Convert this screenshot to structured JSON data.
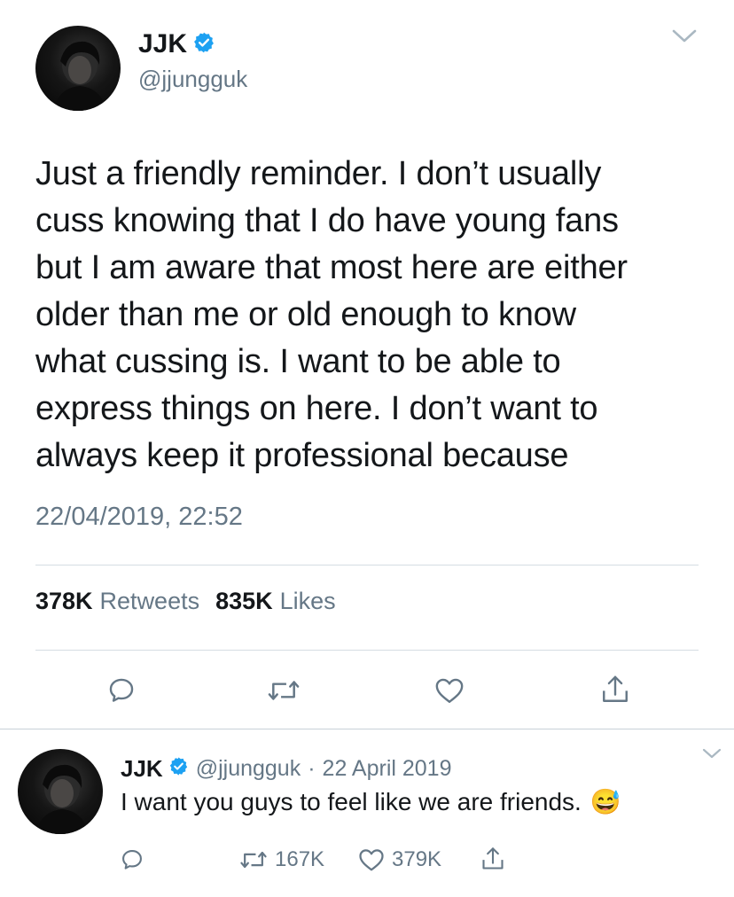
{
  "main_tweet": {
    "display_name": "JJK",
    "handle": "@jjungguk",
    "text": "Just a friendly reminder. I don’t usually\ncuss knowing that I do have young fans\nbut I am aware that most here are either\nolder than me or old enough to know\nwhat cussing is. I want to be able to\nexpress things on here. I don’t want to\nalways keep it professional because",
    "timestamp": "22/04/2019, 22:52",
    "retweets_count": "378K",
    "retweets_label": "Retweets",
    "likes_count": "835K",
    "likes_label": "Likes"
  },
  "reply_tweet": {
    "display_name": "JJK",
    "handle": "@jjungguk",
    "separator": "·",
    "date": "22 April 2019",
    "text": "I want you guys to feel like we are friends.",
    "emoji": "😅",
    "retweet_count": "167K",
    "like_count": "379K"
  },
  "colors": {
    "verified": "#1da1f2",
    "muted": "#657786",
    "divider": "#d5dde3",
    "text": "#14171a"
  },
  "icons": [
    "verified-badge-icon",
    "chevron-down-icon",
    "reply-icon",
    "retweet-icon",
    "like-icon",
    "share-icon"
  ]
}
